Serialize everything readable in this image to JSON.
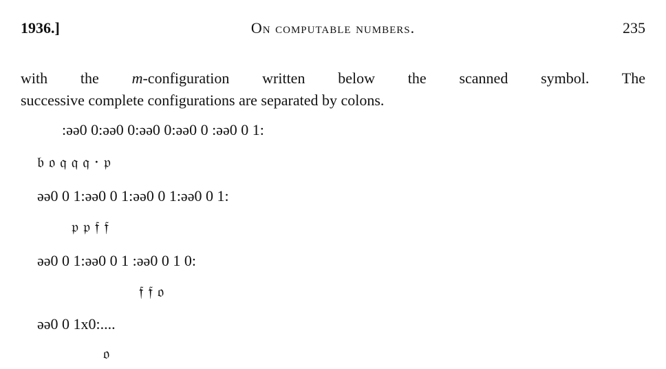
{
  "header": {
    "year": "1936.]",
    "title": "On computable numbers.",
    "page_number": "235"
  },
  "paragraph": {
    "line1_before": "with the ",
    "line1_italic": "m",
    "line1_after": "-configuration written below the scanned symbol. The",
    "line2": "successive complete configurations are separated by colons."
  },
  "configurations": {
    "row1_symbols": ":əə0 0:əə0 0:əə0 0:əə0 0 :əə0 0 1:",
    "row1_mconfigs": "𝔟 𝔬 𝔮 𝔮 𝔮 · 𝔭",
    "row2_symbols": "əə0 0 1:əə0 0 1:əə0 0 1:əə0 0 1:",
    "row2_mconfigs": "𝔭 𝔭 𝔣 𝔣",
    "row3_symbols": "əə0 0 1:əə0 0 1 :əə0 0 1 0:",
    "row3_mconfigs": "𝔣 𝔣 𝔬",
    "row4_symbols": "əə0 0 1x0:....",
    "row4_mconfigs": "𝔬"
  }
}
